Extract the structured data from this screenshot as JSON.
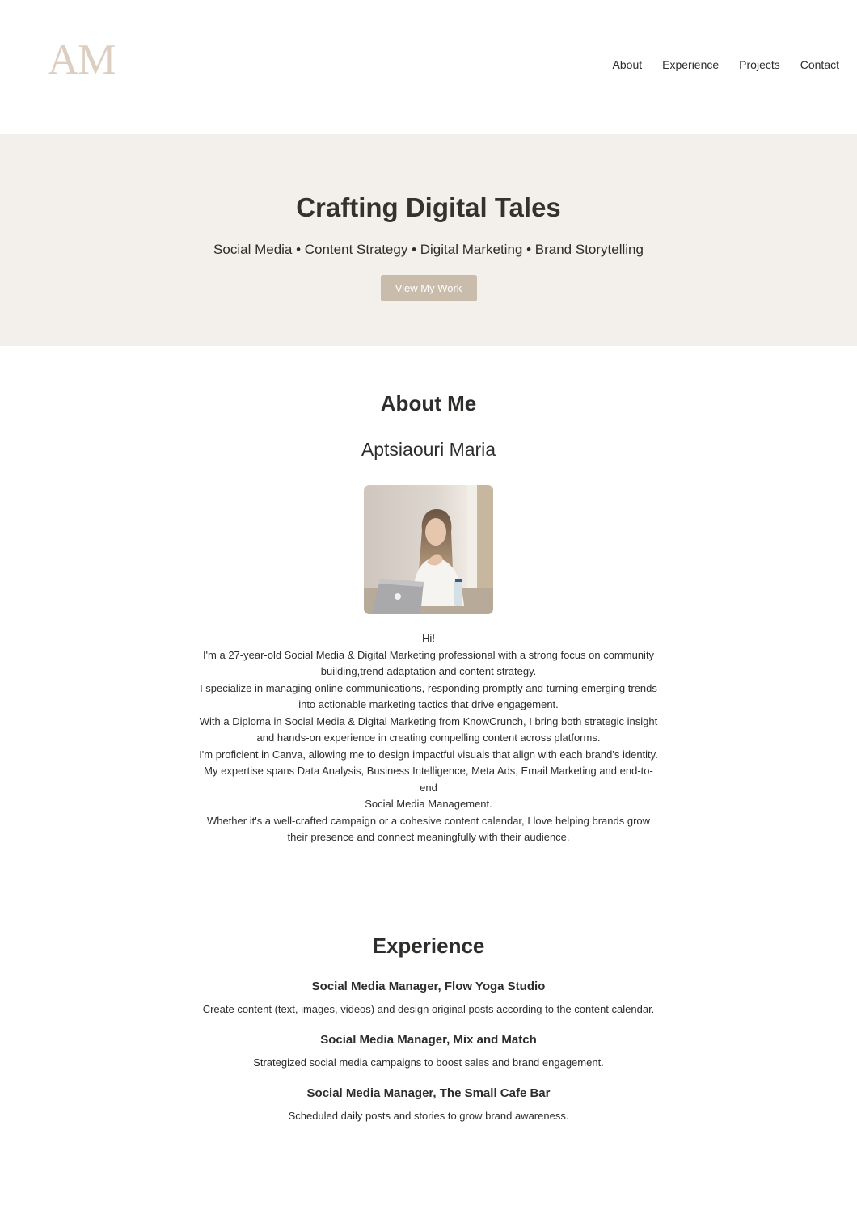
{
  "header": {
    "logo": "AM",
    "nav": [
      "About",
      "Experience",
      "Projects",
      "Contact"
    ]
  },
  "hero": {
    "title": "Crafting Digital Tales",
    "tagline": "Social Media • Content Strategy • Digital Marketing • Brand Storytelling",
    "cta_label": "View My Work"
  },
  "about": {
    "heading": "About Me",
    "name": "Aptsiaouri Maria",
    "photo_alt": "portrait-photo",
    "bio": [
      "Hi!",
      "I'm a 27-year-old Social Media & Digital Marketing professional with a strong focus on community building,trend adaptation and content strategy.",
      "I specialize in managing online communications, responding promptly and turning emerging trends into actionable marketing tactics that drive engagement.",
      "With a Diploma in Social Media & Digital Marketing from KnowCrunch, I bring both strategic insight and hands-on experience in creating compelling content across platforms.",
      "I'm proficient in Canva, allowing me to design impactful visuals that align with each brand's identity.",
      "My expertise spans Data Analysis, Business Intelligence, Meta Ads, Email Marketing and end-to-end",
      "Social Media Management.",
      "Whether it's a well-crafted campaign or a cohesive content calendar, I love helping brands grow their presence and connect meaningfully with their audience."
    ]
  },
  "experience": {
    "heading": "Experience",
    "jobs": [
      {
        "title": "Social Media Manager, Flow Yoga Studio",
        "description": "Create content (text, images, videos) and design original posts according to the content calendar."
      },
      {
        "title": "Social Media Manager, Mix and Match",
        "description": "Strategized social media campaigns to boost sales and brand engagement."
      },
      {
        "title": "Social Media Manager, The Small Cafe Bar",
        "description": "Scheduled daily posts and stories to grow brand awareness."
      }
    ]
  },
  "colors": {
    "logo": "#dccfc1",
    "hero_bg": "#f3f0eb",
    "button_bg": "#c9bcab",
    "text": "#2d2d2b"
  }
}
